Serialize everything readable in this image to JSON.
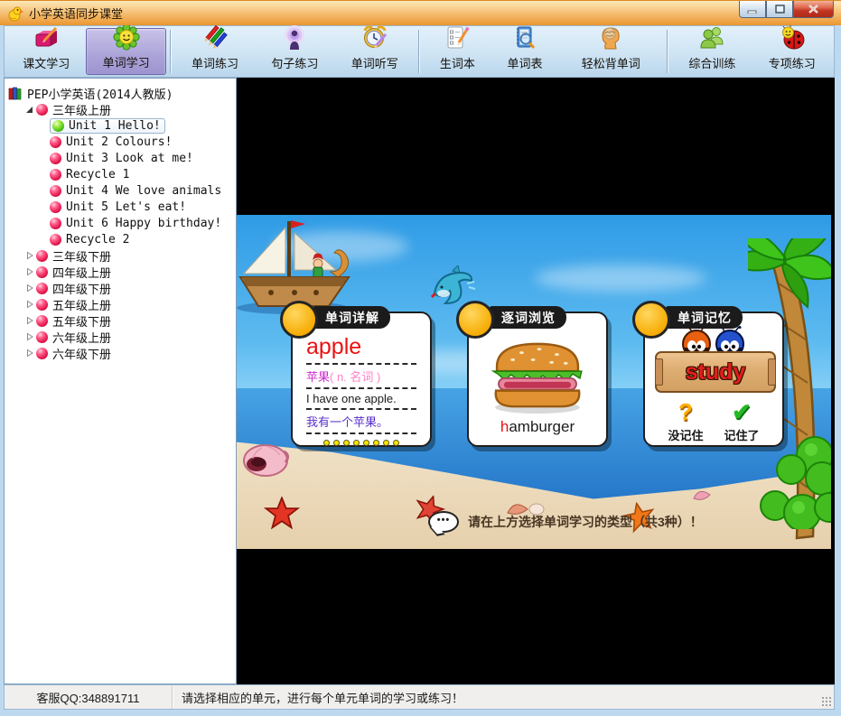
{
  "window": {
    "title": "小学英语同步课堂"
  },
  "toolbar": {
    "buttons": [
      {
        "label": "课文学习",
        "icon": "book-pencil-icon",
        "selected": false
      },
      {
        "label": "单词学习",
        "icon": "flower-smiley-icon",
        "selected": true
      },
      {
        "label": "单词练习",
        "icon": "color-pencils-icon",
        "selected": false
      },
      {
        "label": "句子练习",
        "icon": "broadcast-person-icon",
        "selected": false
      },
      {
        "label": "单词听写",
        "icon": "alarm-clock-pencil-icon",
        "selected": false
      },
      {
        "label": "生词本",
        "icon": "notepad-pencil-icon",
        "selected": false
      },
      {
        "label": "单词表",
        "icon": "wordlist-magnifier-icon",
        "selected": false
      },
      {
        "label": "轻松背单词",
        "icon": "head-brain-icon",
        "selected": false
      },
      {
        "label": "综合训练",
        "icon": "people-icon",
        "selected": false
      },
      {
        "label": "专项练习",
        "icon": "ladybug-icon",
        "selected": false
      }
    ]
  },
  "tree": {
    "root_label": "PEP小学英语(2014人教版)",
    "items": [
      {
        "label": "三年级上册",
        "type": "book",
        "state": "expanded"
      },
      {
        "label": "Unit 1 Hello!",
        "type": "unit",
        "selected": true
      },
      {
        "label": "Unit 2 Colours!",
        "type": "unit"
      },
      {
        "label": "Unit 3 Look at me!",
        "type": "unit"
      },
      {
        "label": "Recycle 1",
        "type": "unit"
      },
      {
        "label": "Unit 4 We love animals",
        "type": "unit"
      },
      {
        "label": "Unit 5 Let's eat!",
        "type": "unit"
      },
      {
        "label": "Unit 6 Happy birthday!",
        "type": "unit"
      },
      {
        "label": "Recycle 2",
        "type": "unit"
      },
      {
        "label": "三年级下册",
        "type": "book",
        "state": "collapsed"
      },
      {
        "label": "四年级上册",
        "type": "book",
        "state": "collapsed"
      },
      {
        "label": "四年级下册",
        "type": "book",
        "state": "collapsed"
      },
      {
        "label": "五年级上册",
        "type": "book",
        "state": "collapsed"
      },
      {
        "label": "五年级下册",
        "type": "book",
        "state": "collapsed"
      },
      {
        "label": "六年级上册",
        "type": "book",
        "state": "collapsed"
      },
      {
        "label": "六年级下册",
        "type": "book",
        "state": "collapsed"
      }
    ]
  },
  "cards": {
    "detail": {
      "title": "单词详解",
      "word": "apple",
      "meaning": "苹果",
      "pos": "( n. 名词 )",
      "example_en": "I have one apple.",
      "example_zh": "我有一个苹果。",
      "page_dots": 8
    },
    "browse": {
      "title": "逐词浏览",
      "word_initial": "h",
      "word_rest": "amburger"
    },
    "memory": {
      "title": "单词记忆",
      "word": "study",
      "btn_forgot": "没记住",
      "btn_remembered": "记住了"
    }
  },
  "scene": {
    "hint": "请在上方选择单词学习的类型（共3种）！"
  },
  "statusbar": {
    "qq": "客服QQ:348891711",
    "message": "请选择相应的单元，进行每个单元单词的学习或练习！"
  },
  "colors": {
    "titlebar_orange": "#ee9f3e",
    "toolbar_blue": "#cfe4f4",
    "selected_button_purple": "#aba3d8",
    "word_red": "#ec1212",
    "meaning_magenta": "#cc2ccc",
    "example_zh_purple": "#5a31cc",
    "sky_blue": "#55b7ef",
    "sand": "#ecd9ba"
  }
}
